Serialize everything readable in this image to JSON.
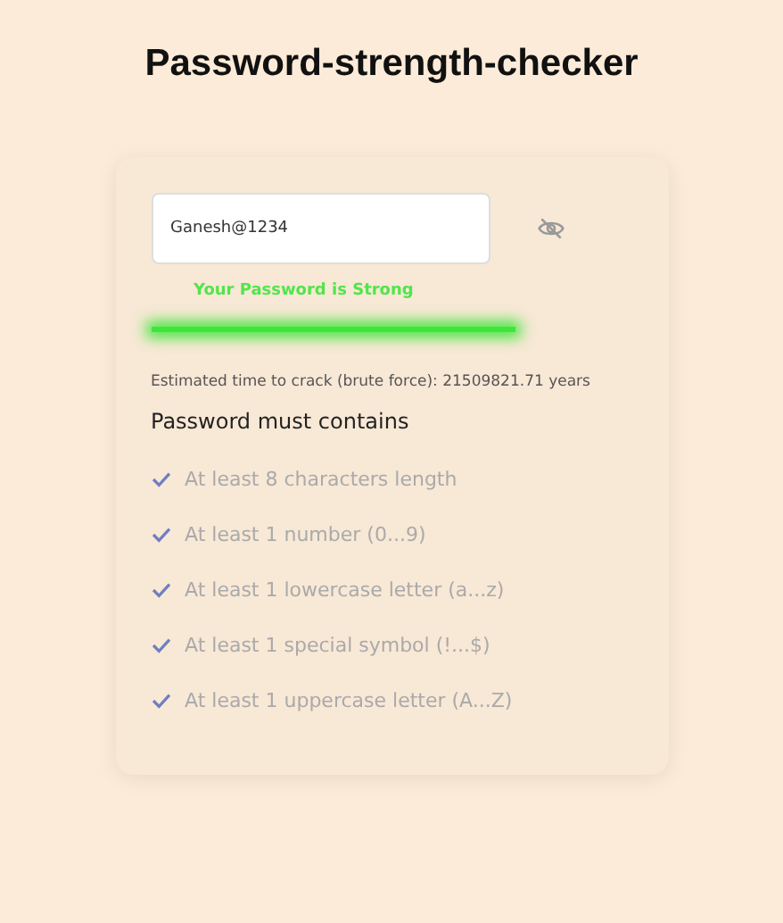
{
  "title": "Password-strength-checker",
  "password": {
    "value": "Ganesh@1234",
    "visible": true
  },
  "strength": {
    "message": "Your Password is Strong",
    "color": "#3ee63a"
  },
  "estimate": "Estimated time to crack (brute force): 21509821.71 years",
  "requirements_title": "Password must contains",
  "requirements": [
    {
      "label": "At least 8 characters length",
      "met": true
    },
    {
      "label": "At least 1 number (0...9)",
      "met": true
    },
    {
      "label": "At least 1 lowercase letter (a...z)",
      "met": true
    },
    {
      "label": "At least 1 special symbol (!...$)",
      "met": true
    },
    {
      "label": "At least 1 uppercase letter (A...Z)",
      "met": true
    }
  ]
}
